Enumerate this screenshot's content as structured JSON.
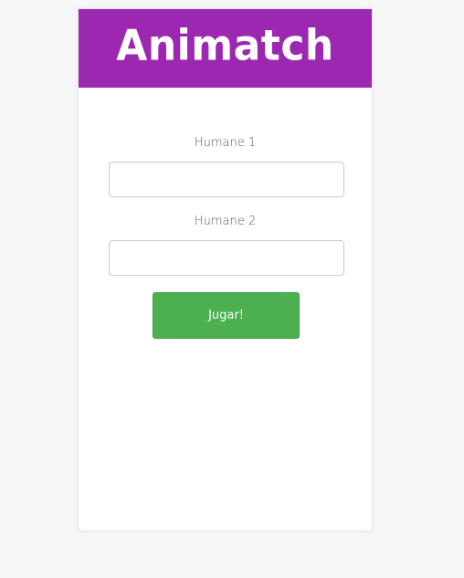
{
  "app": {
    "title": "Animatch"
  },
  "form": {
    "player1": {
      "label": "Humane 1",
      "value": "",
      "placeholder": ""
    },
    "player2": {
      "label": "Humane 2",
      "value": "",
      "placeholder": ""
    },
    "submit_label": "Jugar!"
  },
  "colors": {
    "header": "#9c27b0",
    "button": "#4caf50",
    "page_background": "#f6f7f7"
  }
}
